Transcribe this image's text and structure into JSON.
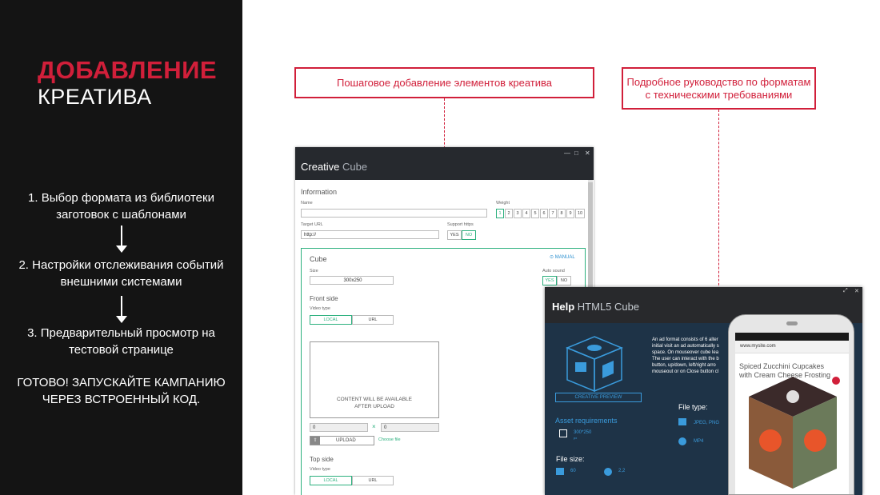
{
  "slide": {
    "title_red": "ДОБАВЛЕНИЕ",
    "title_white": "КРЕАТИВА",
    "steps": [
      "1. Выбор формата из библиотеки\nзаготовок с шаблонами",
      "2. Настройки отслеживания событий\nвнешними системами",
      "3. Предварительный просмотр на\nтестовой странице"
    ],
    "done": "ГОТОВО! ЗАПУСКАЙТЕ КАМПАНИЮ\nЧЕРЕЗ ВСТРОЕННЫЙ КОД."
  },
  "callouts": {
    "left": "Пошаговое добавление элементов креатива",
    "right": "Подробное руководство по форматам\nс техническими требованиями"
  },
  "accent": "#d11f3a",
  "green": "#2cb07e",
  "editor": {
    "title_a": "Creative",
    "title_b": "Cube",
    "section": "Information",
    "name_label": "Name",
    "weight_label": "Weight",
    "weights": [
      "1",
      "2",
      "3",
      "4",
      "5",
      "6",
      "7",
      "8",
      "9",
      "10"
    ],
    "target_label": "Target URL",
    "target_value": "http://",
    "https_label": "Support https",
    "yes": "YES",
    "no": "NO",
    "cube_title": "Cube",
    "manual": "MANUAL",
    "size_label": "Size",
    "size_value": "300x250",
    "auto_sound": "Auto sound",
    "front": "Front side",
    "video_type": "Video type",
    "local": "LOCAL",
    "url": "URL",
    "content_msg": "CONTENT WILL BE AVAILABLE\nAFTER UPLOAD",
    "x_val": "0",
    "y_val": "0",
    "upload": "UPLOAD",
    "choose": "Choose file",
    "top": "Top side"
  },
  "help": {
    "title_a": "Help",
    "title_b": "HTML5 Cube",
    "desc": "An ad format consists of 6 alter\ninitial visit an ad automatically s\nspace. On mouseover cube lea\nThe user can interact with the b\nbutton, up/down, left/right arro\nmouseout or on Close button cl",
    "preview": "CREATIVE PREVIEW",
    "asset": "Asset requirements",
    "asset_size": "300*250",
    "asset_unit": "px",
    "file_type": "File type:",
    "jpeg": "JPEG, PNG",
    "mp4": "MP4",
    "file_size": "File size:",
    "s1": "60",
    "s2": "2,2"
  },
  "phone": {
    "url": "www.mysite.com",
    "headline": "Spiced Zucchini Cupcakes\nwith Cream Cheese Frosting"
  }
}
